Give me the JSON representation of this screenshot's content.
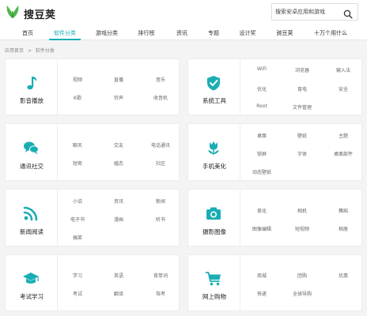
{
  "app": {
    "logo_text": "搜豆荚",
    "search_placeholder": "搜索安卓应用和游戏"
  },
  "nav": {
    "items": [
      "首页",
      "软件分类",
      "游戏分类",
      "排行榜",
      "资讯",
      "专题",
      "设计奖",
      "豌豆荚",
      "十万个用什么"
    ],
    "active_index": 1
  },
  "breadcrumb": [
    "应用首页",
    ">",
    "软件分类"
  ],
  "colors": {
    "accent": "#1aaeb4",
    "tag_text": "#666666"
  },
  "categories": [
    {
      "title": "影音播放",
      "icon": "music-note-icon",
      "tags": [
        "视频",
        "直播",
        "音乐",
        "K歌",
        "铃声",
        "收音机"
      ]
    },
    {
      "title": "系统工具",
      "icon": "shield-check-icon",
      "tags": [
        "WiFi",
        "浏览器",
        "输入法",
        "优化",
        "育电",
        "安全",
        "Root",
        "文件管理"
      ]
    },
    {
      "title": "通讯社交",
      "icon": "chat-bubbles-icon",
      "tags": [
        "聊天",
        "交友",
        "电话通讯",
        "短密",
        "婚恋",
        "社区"
      ]
    },
    {
      "title": "手机美化",
      "icon": "tulip-icon",
      "tags": [
        "桌面",
        "壁纸",
        "主题",
        "锁屏",
        "字体",
        "桌面部件",
        "动态壁纸"
      ]
    },
    {
      "title": "新闻阅读",
      "icon": "rss-feed-icon",
      "tags": [
        "小说",
        "资讯",
        "新闻",
        "电子书",
        "漫画",
        "听书",
        "搞笑"
      ]
    },
    {
      "title": "摄影图像",
      "icon": "camera-icon",
      "tags": [
        "美化",
        "相机",
        "舞蹈",
        "图像编辑",
        "短视频",
        "相册"
      ]
    },
    {
      "title": "考试学习",
      "icon": "graduation-cap-icon",
      "tags": [
        "学习",
        "英语",
        "背单词",
        "考试",
        "翻译",
        "驾考"
      ]
    },
    {
      "title": "网上购物",
      "icon": "shopping-cart-icon",
      "tags": [
        "商城",
        "团购",
        "优惠",
        "快递",
        "全球导购"
      ]
    }
  ]
}
